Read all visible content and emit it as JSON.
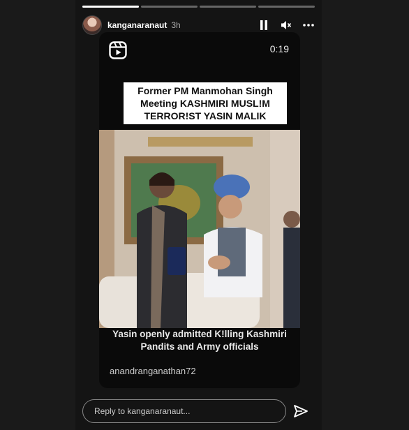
{
  "story": {
    "progress": [
      1,
      0,
      0,
      0
    ]
  },
  "header": {
    "username": "kanganaranaut",
    "time": "3h"
  },
  "reel": {
    "duration": "0:19",
    "title": "Former PM Manmohan Singh Meeting KASHMIRI MUSL!M TERROR!ST YASIN MALIK",
    "caption": "Yasin openly admitted K!lling Kashmiri Pandits and Army officials",
    "handle": "anandranganathan72"
  },
  "reply": {
    "placeholder": "Reply to kanganaranaut..."
  },
  "icons": [
    "reel-icon",
    "pause-icon",
    "mute-icon",
    "more-icon",
    "send-icon"
  ],
  "colors": {
    "background": "#1a1a1a",
    "story": "#141414",
    "title_bg": "#ffffff"
  }
}
